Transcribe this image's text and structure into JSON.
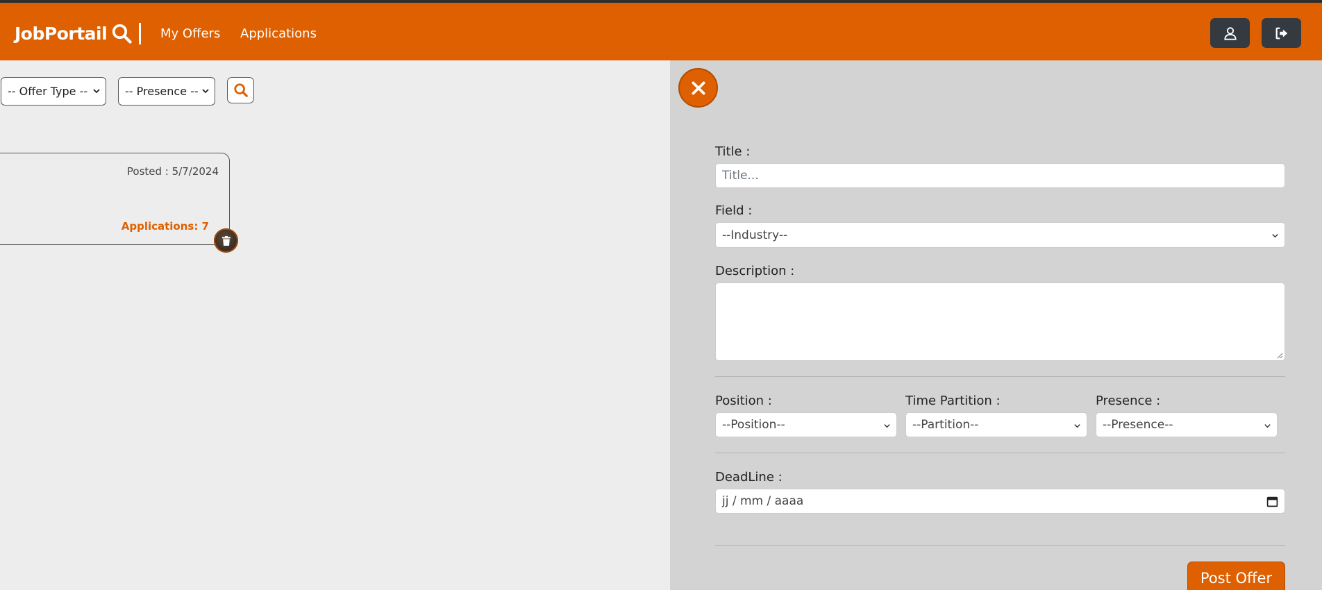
{
  "navbar": {
    "brand": "JobPortail",
    "links": [
      "My Offers",
      "Applications"
    ]
  },
  "filters": {
    "offer_type": "-- Offer Type --",
    "presence": "-- Presence --"
  },
  "offer_card": {
    "posted": "Posted : 5/7/2024",
    "applications": "Applications: 7"
  },
  "form": {
    "title_label": "Title :",
    "title_placeholder": "Title...",
    "field_label": "Field :",
    "field_value": "--Industry--",
    "description_label": "Description :",
    "description_value": "",
    "position_label": "Position :",
    "position_value": "--Position--",
    "time_label": "Time Partition :",
    "time_value": "--Partition--",
    "presence_label": "Presence :",
    "presence_value": "--Presence--",
    "deadline_label": "DeadLine :",
    "deadline_placeholder": "jj / mm / aaaa",
    "submit": "Post Offer"
  },
  "colors": {
    "brand_orange": "#de6000",
    "dark_button": "#343a40",
    "panel_bg": "#d3d3d3",
    "page_bg": "#ededed"
  },
  "icons": [
    "search-icon",
    "user-icon",
    "logout-icon",
    "chevron-down-icon",
    "trash-icon",
    "close-icon",
    "calendar-icon"
  ]
}
